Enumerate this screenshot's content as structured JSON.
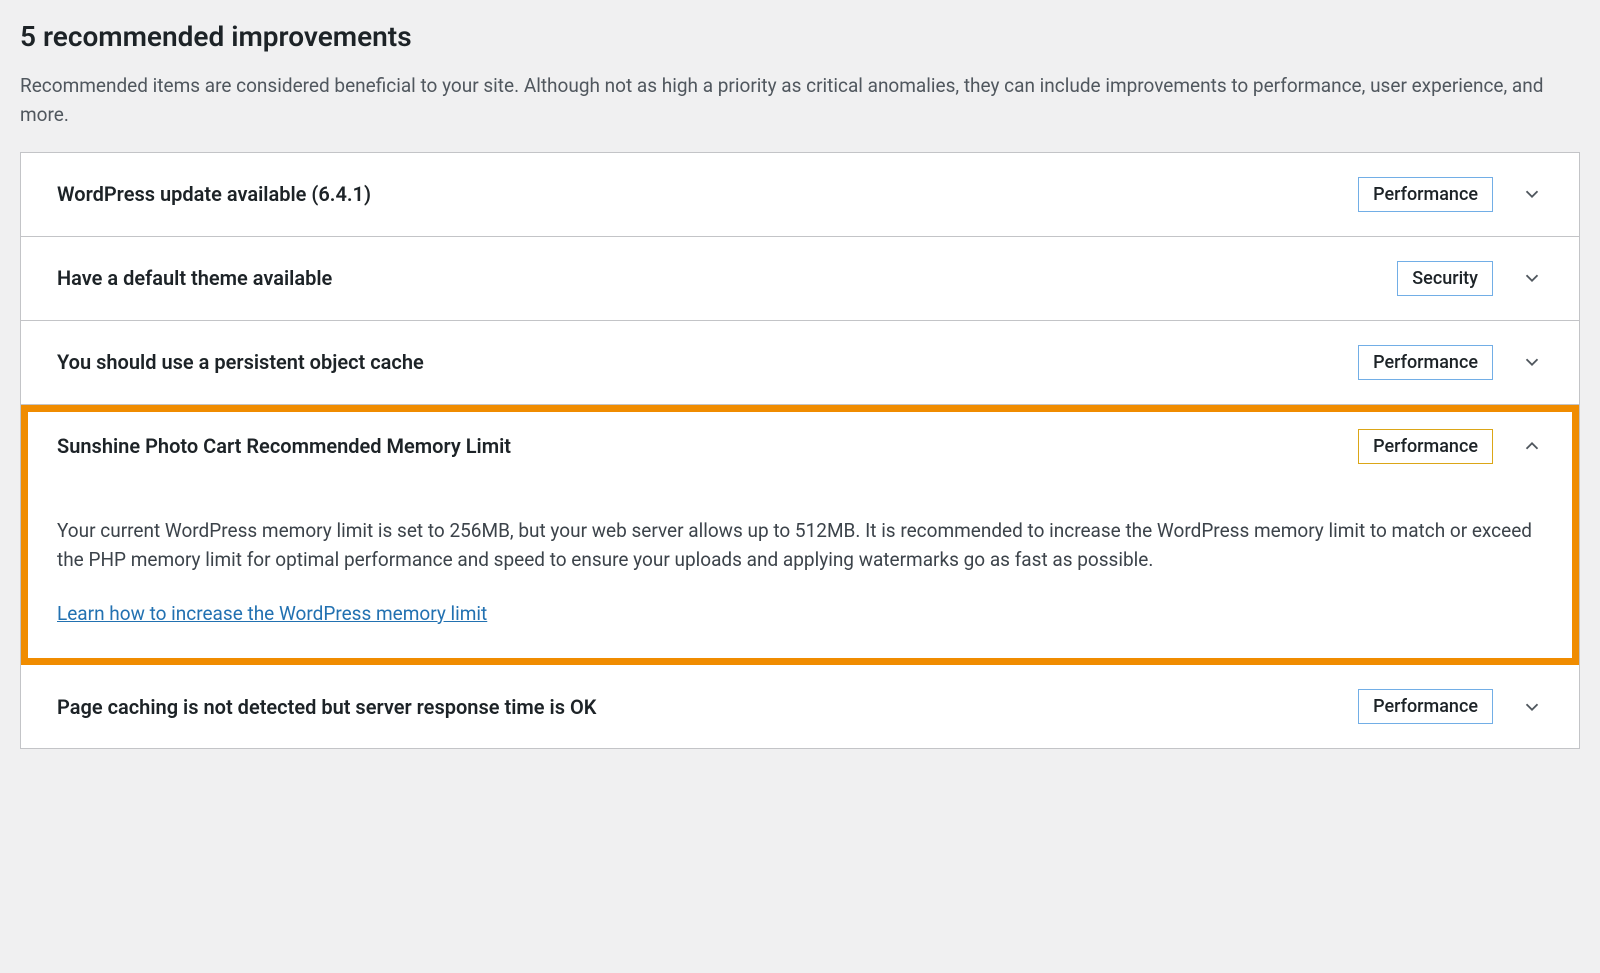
{
  "header": {
    "title": "5 recommended improvements",
    "description": "Recommended items are considered beneficial to your site. Although not as high a priority as critical anomalies, they can include improvements to performance, user experience, and more."
  },
  "items": [
    {
      "title": "WordPress update available (6.4.1)",
      "badge": "Performance",
      "badgeColor": "blue",
      "expanded": false
    },
    {
      "title": "Have a default theme available",
      "badge": "Security",
      "badgeColor": "blue",
      "expanded": false
    },
    {
      "title": "You should use a persistent object cache",
      "badge": "Performance",
      "badgeColor": "blue",
      "expanded": false
    },
    {
      "title": "Sunshine Photo Cart Recommended Memory Limit",
      "badge": "Performance",
      "badgeColor": "orange",
      "expanded": true,
      "highlighted": true,
      "body": "Your current WordPress memory limit is set to 256MB, but your web server allows up to 512MB. It is recommended to increase the WordPress memory limit to match or exceed the PHP memory limit for optimal performance and speed to ensure your uploads and applying watermarks go as fast as possible.",
      "link": "Learn how to increase the WordPress memory limit"
    },
    {
      "title": "Page caching is not detected but server response time is OK",
      "badge": "Performance",
      "badgeColor": "blue",
      "expanded": false
    }
  ]
}
